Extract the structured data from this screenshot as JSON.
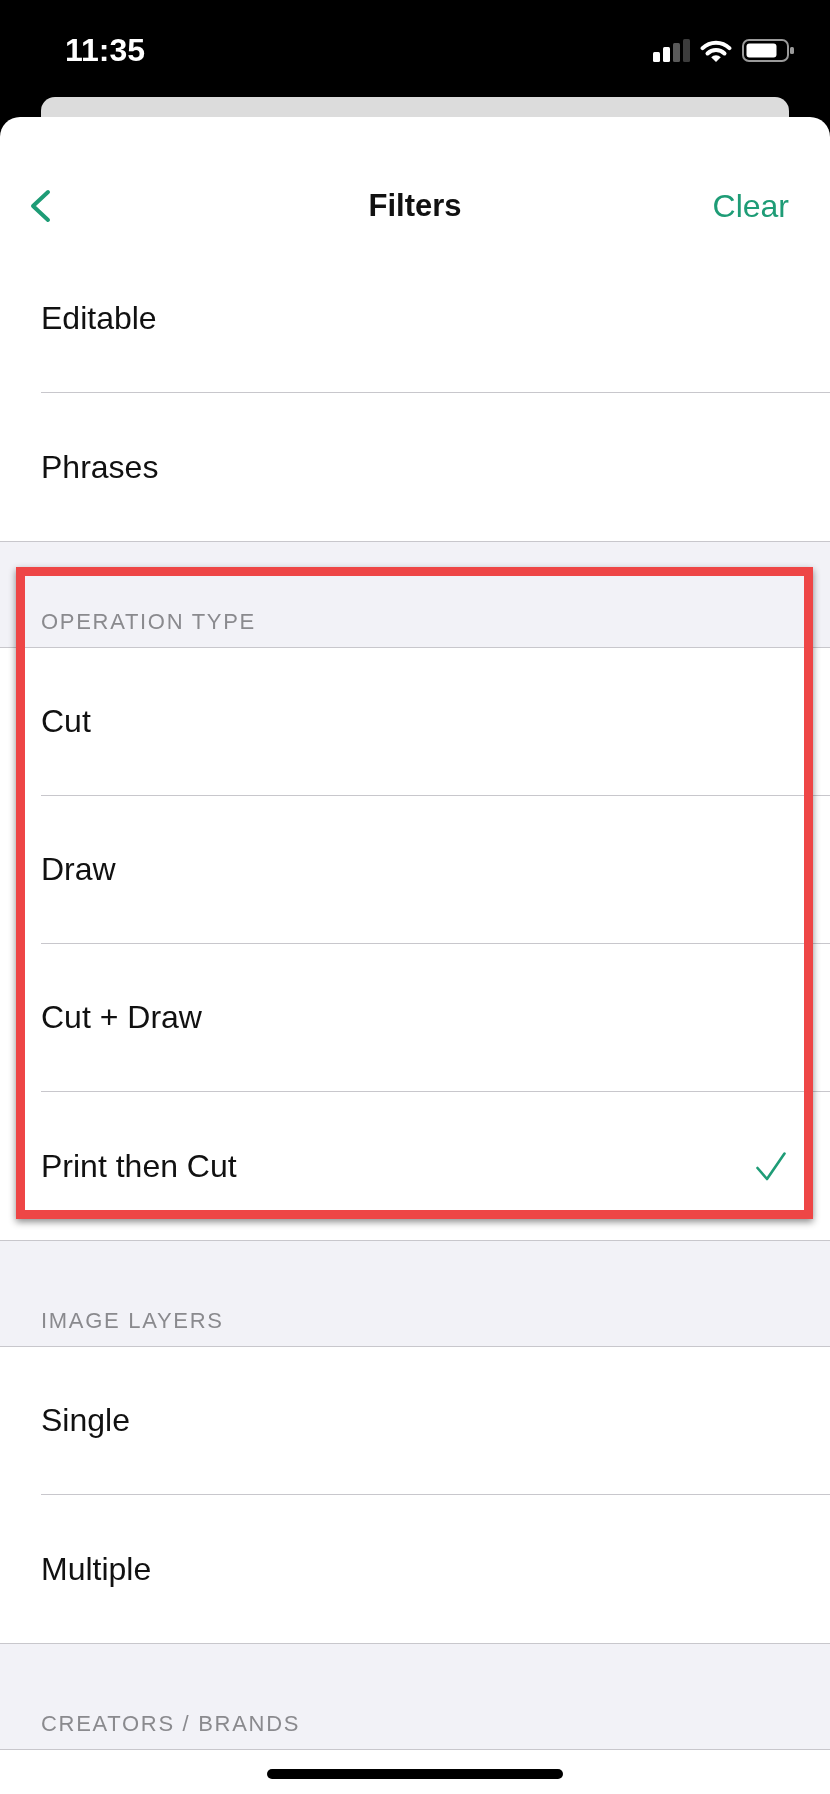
{
  "status_bar": {
    "time": "11:35"
  },
  "nav_bar": {
    "title": "Filters",
    "action": "Clear"
  },
  "sections": [
    {
      "highlighted": false,
      "items": [
        {
          "label": "Editable",
          "checked": false
        },
        {
          "label": "Phrases",
          "checked": false
        }
      ]
    },
    {
      "header": "OPERATION TYPE",
      "highlighted": true,
      "items": [
        {
          "label": "Cut",
          "checked": false
        },
        {
          "label": "Draw",
          "checked": false
        },
        {
          "label": "Cut + Draw",
          "checked": false
        },
        {
          "label": "Print then Cut",
          "checked": true
        }
      ]
    },
    {
      "header": "IMAGE LAYERS",
      "highlighted": false,
      "items": [
        {
          "label": "Single",
          "checked": false
        },
        {
          "label": "Multiple",
          "checked": false
        }
      ]
    },
    {
      "header": "CREATORS / BRANDS",
      "highlighted": false
    }
  ]
}
